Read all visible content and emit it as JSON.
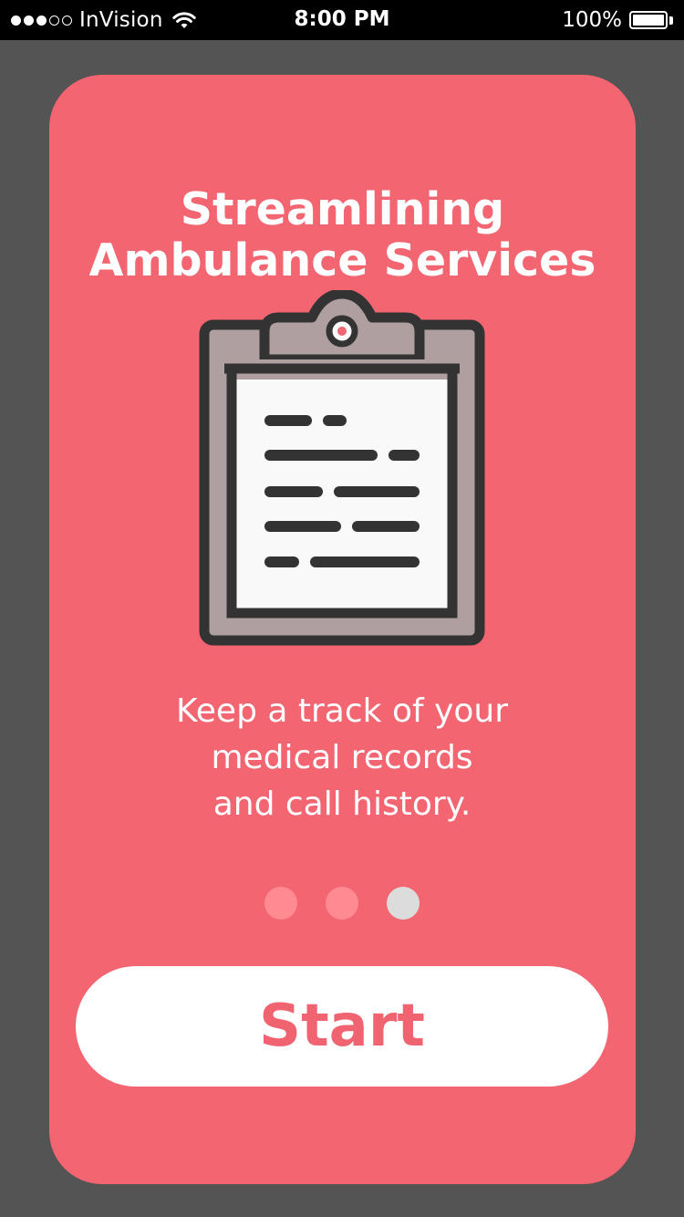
{
  "status_bar": {
    "carrier": "InVision",
    "time": "8:00 PM",
    "battery_percent": "100%",
    "battery_level": 1.0,
    "signal_bars_filled": 3,
    "signal_bars_total": 5,
    "icons": [
      "wifi-icon",
      "battery-icon"
    ]
  },
  "onboarding": {
    "title_line1": "Streamlining",
    "title_line2": "Ambulance Services",
    "illustration": "clipboard-icon",
    "description_line1": "Keep a track of your",
    "description_line2": "medical records",
    "description_line3": "and call history.",
    "pager": {
      "total": 3,
      "active_index": 2
    },
    "start_label": "Start"
  },
  "colors": {
    "background": "#545454",
    "card": "#f26571",
    "button": "#ffffff",
    "button_text": "#ef6470",
    "pager_inactive": "#ff8a91",
    "pager_active": "#dcdcdc",
    "clipboard_board": "#b09fa1",
    "clipboard_paper": "#f9f9f9",
    "clipboard_outline": "#333333"
  }
}
